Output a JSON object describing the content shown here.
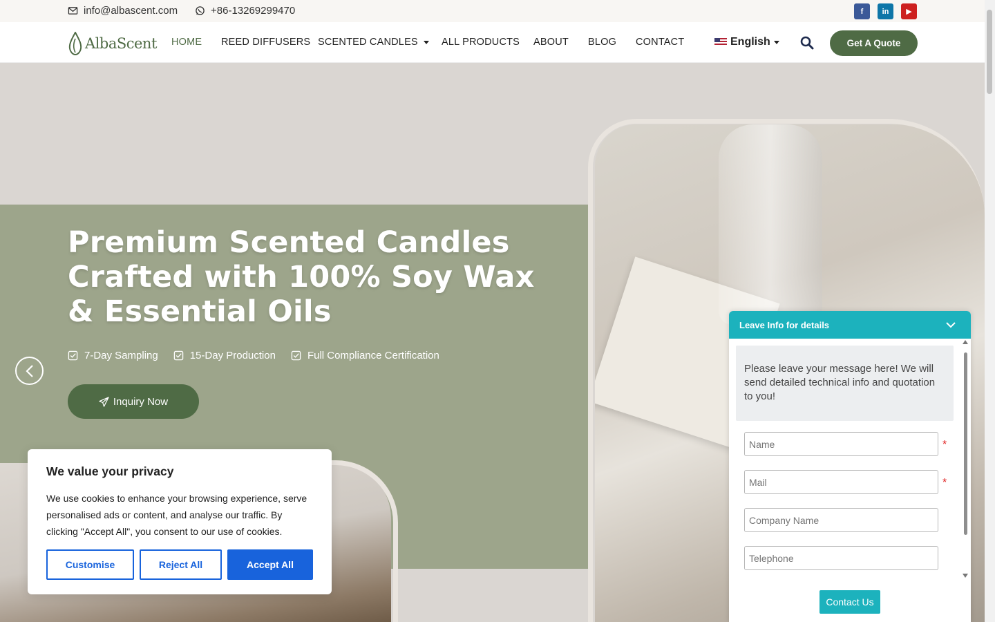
{
  "topbar": {
    "email": "info@albascent.com",
    "phone": "+86-13269299470",
    "social_icons": [
      "facebook-icon",
      "linkedin-icon",
      "youtube-icon"
    ]
  },
  "nav": {
    "logo_text": "AlbaScent",
    "items": [
      "HOME",
      "REED DIFFUSERS",
      "SCENTED CANDLES",
      "ALL PRODUCTS",
      "ABOUT",
      "BLOG",
      "CONTACT"
    ],
    "active": "HOME",
    "language": "English",
    "quote_button": "Get A Quote"
  },
  "hero": {
    "title": "Premium Scented Candles Crafted with 100% Soy Wax & Essential Oils",
    "features": [
      "7-Day Sampling",
      "15-Day Production",
      "Full Compliance Certification"
    ],
    "cta": "Inquiry Now"
  },
  "cookie": {
    "title": "We value your privacy",
    "text": "We use cookies to enhance your browsing experience, serve personalised ads or content, and analyse our traffic. By clicking \"Accept All\", you consent to our use of cookies.",
    "customise": "Customise",
    "reject": "Reject All",
    "accept": "Accept All"
  },
  "chat": {
    "header": "Leave Info for details",
    "message": "Please leave your message here! We will send detailed technical info and quotation to you!",
    "fields": {
      "name": "Name",
      "mail": "Mail",
      "company": "Company Name",
      "telephone": "Telephone"
    },
    "required_mark": "*",
    "submit": "Contact Us"
  },
  "colors": {
    "brand_green": "#4f6b45",
    "hero_green": "#9da58b",
    "cookie_blue": "#1863dc",
    "chat_teal": "#1cb2bd"
  }
}
